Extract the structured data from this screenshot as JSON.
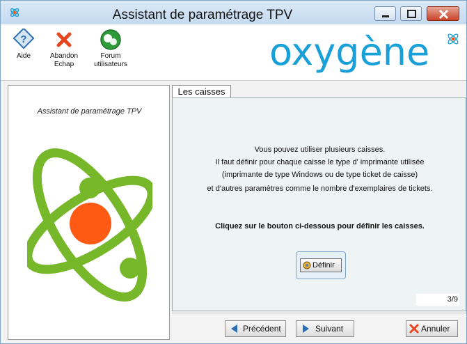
{
  "window": {
    "title": "Assistant de paramétrage TPV"
  },
  "toolbar": {
    "help": {
      "label": "Aide",
      "icon": "help-icon"
    },
    "abort": {
      "label_line1": "Abandon",
      "label_line2": "Echap",
      "icon": "close-icon"
    },
    "forum": {
      "label_line1": "Forum",
      "label_line2": "utilisateurs",
      "icon": "forum-icon"
    }
  },
  "brand": {
    "logo_text": "oxygène",
    "color": "#1aa0d8"
  },
  "left_panel": {
    "title": "Assistant de paramétrage TPV"
  },
  "tab": {
    "label": "Les caisses"
  },
  "content": {
    "lines": [
      "Vous pouvez utiliser plusieurs caisses.",
      "Il faut définir pour chaque caisse le type d' imprimante utilisée",
      "(imprimante de type Windows ou de type ticket de caisse)",
      "et d'autres paramètres comme le nombre d'exemplaires de tickets."
    ],
    "instruction": "Cliquez sur le bouton ci-dessous pour définir les caisses.",
    "define_button": "Définir",
    "page": "3/9"
  },
  "navigation": {
    "previous": "Précédent",
    "next": "Suivant",
    "cancel": "Annuler"
  },
  "colors": {
    "atom_green": "#76b82a",
    "atom_core": "#ff5a14",
    "accent_blue": "#2a6fb5"
  }
}
